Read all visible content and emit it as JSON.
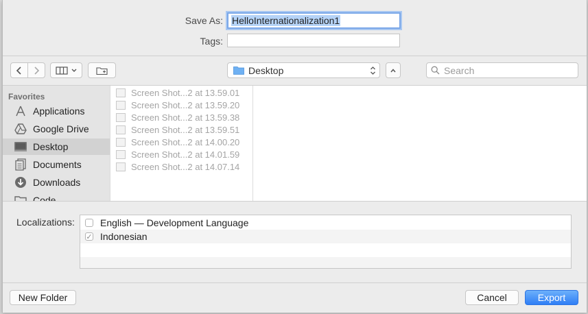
{
  "save_as": {
    "label": "Save As:",
    "value": "HelloInternationalization1"
  },
  "tags": {
    "label": "Tags:",
    "value": ""
  },
  "toolbar": {
    "back_icon": "chevron-left-icon",
    "forward_icon": "chevron-right-icon",
    "view_icon": "column-view-icon",
    "new_folder_icon": "folder-plus-icon",
    "location": "Desktop",
    "search_placeholder": "Search"
  },
  "sidebar": {
    "heading": "Favorites",
    "items": [
      {
        "label": "Applications",
        "icon": "applications-icon"
      },
      {
        "label": "Google Drive",
        "icon": "google-drive-icon"
      },
      {
        "label": "Desktop",
        "icon": "desktop-icon",
        "selected": true
      },
      {
        "label": "Documents",
        "icon": "documents-icon"
      },
      {
        "label": "Downloads",
        "icon": "downloads-icon"
      },
      {
        "label": "Code",
        "icon": "folder-icon"
      }
    ]
  },
  "files": [
    "Screen Shot...2 at 13.59.01",
    "Screen Shot...2 at 13.59.20",
    "Screen Shot...2 at 13.59.38",
    "Screen Shot...2 at 13.59.51",
    "Screen Shot...2 at 14.00.20",
    "Screen Shot...2 at 14.01.59",
    "Screen Shot...2 at 14.07.14"
  ],
  "localizations": {
    "label": "Localizations:",
    "items": [
      {
        "label": "English — Development Language",
        "checked": false
      },
      {
        "label": "Indonesian",
        "checked": true
      }
    ]
  },
  "buttons": {
    "new_folder": "New Folder",
    "cancel": "Cancel",
    "export": "Export"
  },
  "colors": {
    "accent": "#2f7ef5",
    "selection": "#b5d3f7"
  }
}
